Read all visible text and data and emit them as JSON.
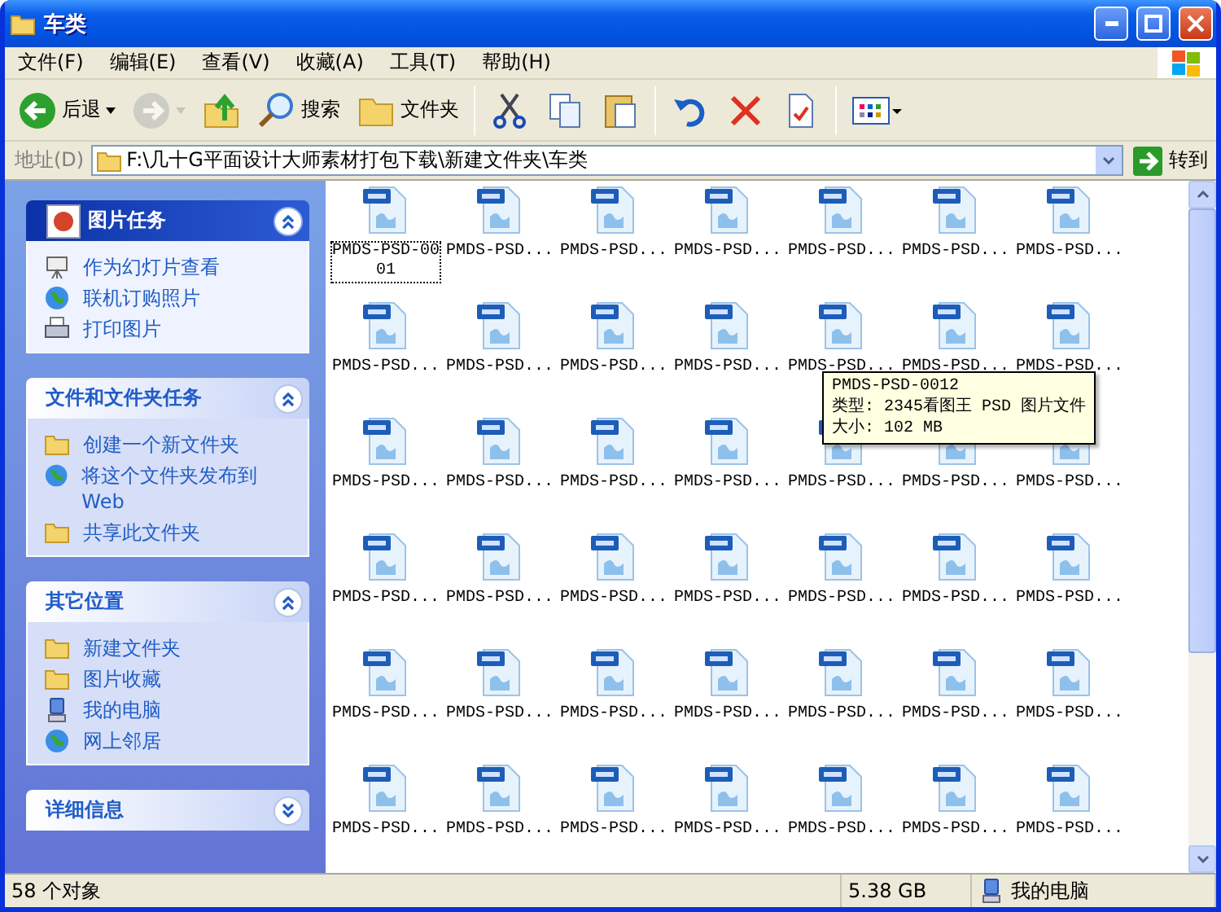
{
  "window": {
    "title": "车类"
  },
  "menu": [
    "文件(F)",
    "编辑(E)",
    "查看(V)",
    "收藏(A)",
    "工具(T)",
    "帮助(H)"
  ],
  "toolbar": [
    {
      "kind": "back",
      "label": "后退",
      "disabled": false
    },
    {
      "kind": "forward",
      "disabled": true
    },
    {
      "kind": "up",
      "disabled": false
    },
    {
      "kind": "search",
      "label": "搜索",
      "disabled": false
    },
    {
      "kind": "folders",
      "label": "文件夹",
      "disabled": false
    },
    {
      "kind": "cut",
      "disabled": false
    },
    {
      "kind": "copy",
      "disabled": false
    },
    {
      "kind": "paste",
      "disabled": false
    },
    {
      "kind": "undo",
      "disabled": false
    },
    {
      "kind": "delete",
      "disabled": false
    },
    {
      "kind": "properties",
      "disabled": false
    },
    {
      "kind": "views",
      "disabled": false
    }
  ],
  "address": {
    "label": "地址(D)",
    "value": "F:\\几十G平面设计大师素材打包下载\\新建文件夹\\车类",
    "go": "转到"
  },
  "sidebar": [
    {
      "title": "图片任务",
      "kind": "special",
      "expanded": true,
      "items": [
        {
          "label": "作为幻灯片查看",
          "kind": "slideshow"
        },
        {
          "label": "联机订购照片",
          "kind": "order"
        },
        {
          "label": "打印图片",
          "kind": "print"
        }
      ]
    },
    {
      "title": "文件和文件夹任务",
      "kind": "normal",
      "expanded": true,
      "items": [
        {
          "label": "创建一个新文件夹",
          "kind": "newfolder"
        },
        {
          "label": "将这个文件夹发布到 Web",
          "kind": "publish"
        },
        {
          "label": "共享此文件夹",
          "kind": "share"
        }
      ]
    },
    {
      "title": "其它位置",
      "kind": "normal",
      "expanded": true,
      "items": [
        {
          "label": "新建文件夹",
          "kind": "folder"
        },
        {
          "label": "图片收藏",
          "kind": "pictures"
        },
        {
          "label": "我的电脑",
          "kind": "computer"
        },
        {
          "label": "网上邻居",
          "kind": "network"
        }
      ]
    },
    {
      "title": "详细信息",
      "kind": "normal",
      "expanded": false
    }
  ],
  "files": [
    {
      "name": "PMDS-PSD-0001",
      "focused": true
    },
    {
      "name": "PMDS-PSD...",
      "focused": false
    },
    {
      "name": "PMDS-PSD...",
      "focused": false
    },
    {
      "name": "PMDS-PSD...",
      "focused": false
    },
    {
      "name": "PMDS-PSD...",
      "focused": false
    },
    {
      "name": "PMDS-PSD...",
      "focused": false
    },
    {
      "name": "PMDS-PSD...",
      "focused": false
    },
    {
      "name": "PMDS-PSD...",
      "focused": false
    },
    {
      "name": "PMDS-PSD...",
      "focused": false
    },
    {
      "name": "PMDS-PSD...",
      "focused": false
    },
    {
      "name": "PMDS-PSD...",
      "focused": false
    },
    {
      "name": "PMDS-PSD...",
      "focused": false
    },
    {
      "name": "PMDS-PSD...",
      "focused": false
    },
    {
      "name": "PMDS-PSD...",
      "focused": false
    },
    {
      "name": "PMDS-PSD...",
      "focused": false
    },
    {
      "name": "PMDS-PSD...",
      "focused": false
    },
    {
      "name": "PMDS-PSD...",
      "focused": false
    },
    {
      "name": "PMDS-PSD...",
      "focused": false
    },
    {
      "name": "PMDS-PSD...",
      "focused": false
    },
    {
      "name": "PMDS-PSD...",
      "focused": false
    },
    {
      "name": "PMDS-PSD...",
      "focused": false
    },
    {
      "name": "PMDS-PSD...",
      "focused": false
    },
    {
      "name": "PMDS-PSD...",
      "focused": false
    },
    {
      "name": "PMDS-PSD...",
      "focused": false
    },
    {
      "name": "PMDS-PSD...",
      "focused": false
    },
    {
      "name": "PMDS-PSD...",
      "focused": false
    },
    {
      "name": "PMDS-PSD...",
      "focused": false
    },
    {
      "name": "PMDS-PSD...",
      "focused": false
    },
    {
      "name": "PMDS-PSD...",
      "focused": false
    },
    {
      "name": "PMDS-PSD...",
      "focused": false
    },
    {
      "name": "PMDS-PSD...",
      "focused": false
    },
    {
      "name": "PMDS-PSD...",
      "focused": false
    },
    {
      "name": "PMDS-PSD...",
      "focused": false
    },
    {
      "name": "PMDS-PSD...",
      "focused": false
    },
    {
      "name": "PMDS-PSD...",
      "focused": false
    },
    {
      "name": "PMDS-PSD...",
      "focused": false
    },
    {
      "name": "PMDS-PSD...",
      "focused": false
    },
    {
      "name": "PMDS-PSD...",
      "focused": false
    },
    {
      "name": "PMDS-PSD...",
      "focused": false
    },
    {
      "name": "PMDS-PSD...",
      "focused": false
    },
    {
      "name": "PMDS-PSD...",
      "focused": false
    },
    {
      "name": "PMDS-PSD...",
      "focused": false
    }
  ],
  "tooltip": {
    "lines": [
      "PMDS-PSD-0012",
      "类型: 2345看图王 PSD 图片文件",
      "大小: 102 MB"
    ]
  },
  "status_bar": {
    "count": "58 个对象",
    "size": "5.38 GB",
    "location": "我的电脑"
  }
}
